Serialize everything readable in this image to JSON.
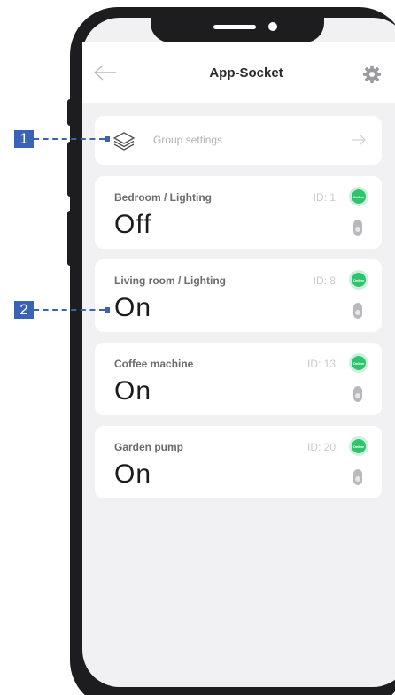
{
  "header": {
    "title": "App-Socket"
  },
  "group": {
    "label": "Group settings"
  },
  "devices": [
    {
      "name": "Bedroom / Lighting",
      "id": "ID: 1",
      "state": "Off",
      "badge": "Online"
    },
    {
      "name": "Living room / Lighting",
      "id": "ID: 8",
      "state": "On",
      "badge": "Online"
    },
    {
      "name": "Coffee machine",
      "id": "ID: 13",
      "state": "On",
      "badge": "Online"
    },
    {
      "name": "Garden pump",
      "id": "ID: 20",
      "state": "On",
      "badge": "Online"
    }
  ],
  "callouts": [
    "1",
    "2"
  ],
  "colors": {
    "accent": "#3a63b5",
    "online": "#2ec46b",
    "frame": "#1d1d1f",
    "background": "#f1f1f3"
  },
  "icons": [
    "back-arrow-icon",
    "gear-icon",
    "layers-icon",
    "arrow-right-icon",
    "switch-icon"
  ]
}
